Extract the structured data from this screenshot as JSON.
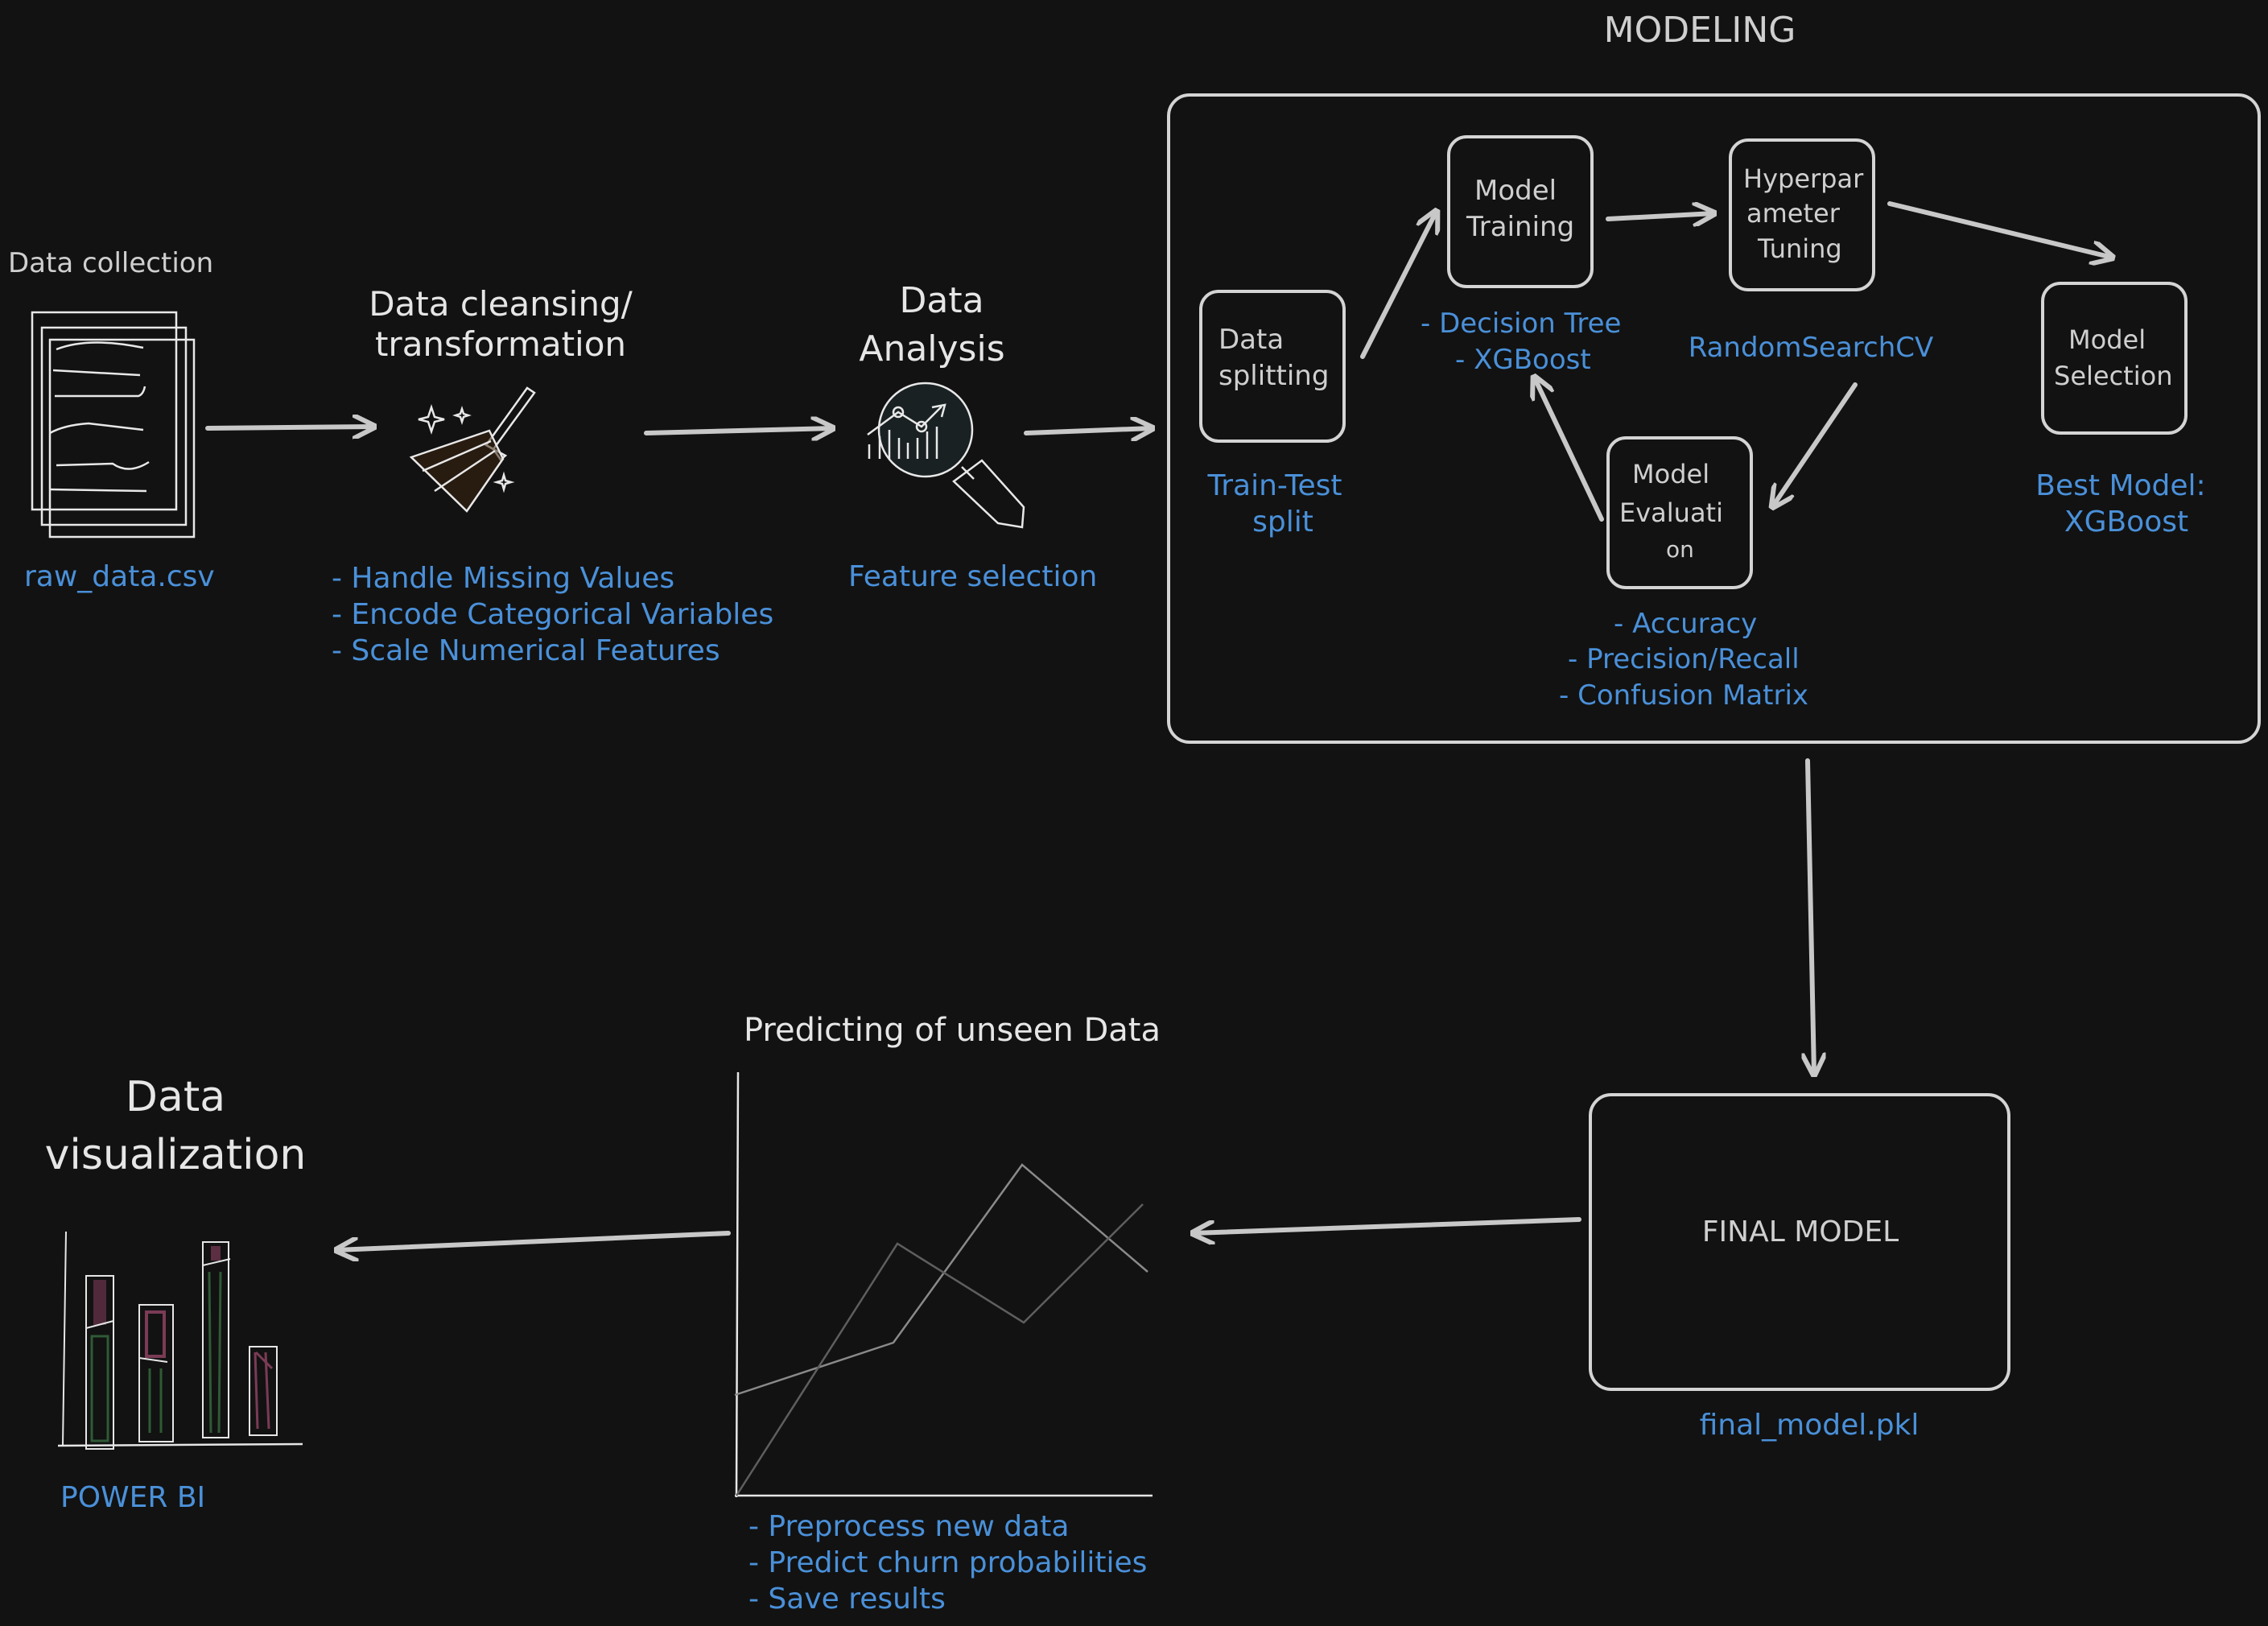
{
  "pipeline": {
    "data_collection": {
      "title": "Data collection",
      "file": "raw_data.csv",
      "icon": "document-stack-icon"
    },
    "data_cleansing": {
      "title_line1": "Data cleansing/",
      "title_line2": "transformation",
      "icon": "broom-icon",
      "steps": [
        "- Handle Missing Values",
        "- Encode Categorical Variables",
        "- Scale Numerical Features"
      ]
    },
    "data_analysis": {
      "title_line1": "Data",
      "title_line2": "Analysis",
      "icon": "magnifier-chart-icon",
      "note": "Feature selection"
    },
    "modeling": {
      "title": "MODELING",
      "data_splitting": {
        "line1": "Data",
        "line2": "splitting",
        "note_line1": "Train-Test",
        "note_line2": "split"
      },
      "model_training": {
        "line1": "Model",
        "line2": "Training",
        "notes": [
          "- Decision Tree",
          "- XGBoost"
        ]
      },
      "hyperparameter_tuning": {
        "line1": "Hyperpar",
        "line2": "ameter",
        "line3": "Tuning",
        "note": "RandomSearchCV"
      },
      "model_evaluation": {
        "line1": "Model",
        "line2": "Evaluati",
        "line3": "on",
        "notes": [
          "- Accuracy",
          "- Precision/Recall",
          "- Confusion Matrix"
        ]
      },
      "model_selection": {
        "line1": "Model",
        "line2": "Selection",
        "note_line1": "Best Model:",
        "note_line2": "XGBoost"
      }
    },
    "final_model": {
      "label": "FINAL MODEL",
      "file": "final_model.pkl"
    },
    "prediction": {
      "title": "Predicting of unseen Data",
      "icon": "line-chart-icon",
      "steps": [
        "- Preprocess new data",
        "- Predict churn probabilities",
        "- Save results"
      ]
    },
    "visualization": {
      "title_line1": "Data",
      "title_line2": "visualization",
      "icon": "bar-chart-icon",
      "tool": "POWER BI"
    }
  },
  "colors": {
    "background": "#121212",
    "text": "#e6e6e6",
    "accent": "#4a90d9",
    "stroke": "#d4d4d4"
  }
}
